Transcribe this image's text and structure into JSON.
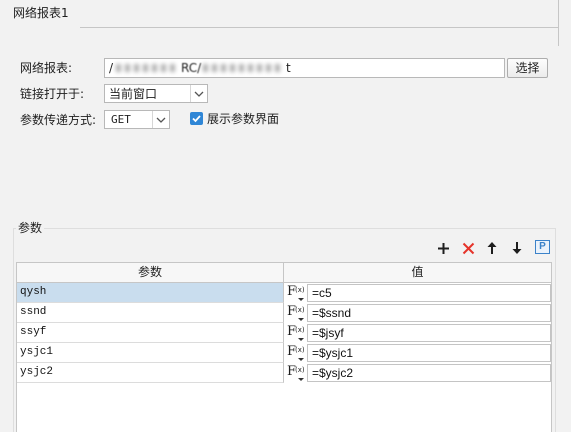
{
  "tab": {
    "title": "网络报表1"
  },
  "form": {
    "report_label": "网络报表:",
    "report_path": {
      "start": "/",
      "middle": "RC/",
      "end": "t"
    },
    "select_button": "选择",
    "open_in_label": "链接打开于:",
    "open_in_value": "当前窗口",
    "method_label": "参数传递方式:",
    "method_value": "GET",
    "show_params": {
      "label": "展示参数界面",
      "checked": true
    }
  },
  "params": {
    "title": "参数",
    "toolbar": {
      "icons": [
        "plus-icon",
        "delete-x-icon",
        "arrow-up-icon",
        "arrow-down-icon",
        "parameter-p-icon"
      ],
      "param_label": "P"
    },
    "table": {
      "headers": {
        "name": "参数",
        "value": "值"
      },
      "formula_icon": {
        "f": "F",
        "x": "(x)"
      },
      "rows": [
        {
          "name": "qysh",
          "value": "=c5",
          "selected": true
        },
        {
          "name": "ssnd",
          "value": "=$ssnd",
          "selected": false
        },
        {
          "name": "ssyf",
          "value": "=$jsyf",
          "selected": false
        },
        {
          "name": "ysjc1",
          "value": "=$ysjc1",
          "selected": false
        },
        {
          "name": "ysjc2",
          "value": "=$ysjc2",
          "selected": false
        }
      ]
    }
  },
  "colors": {
    "accent": "#2f86d6",
    "danger": "#e5332a",
    "selected_row": "#c9ddee",
    "param_icon": "#3b82c9"
  }
}
